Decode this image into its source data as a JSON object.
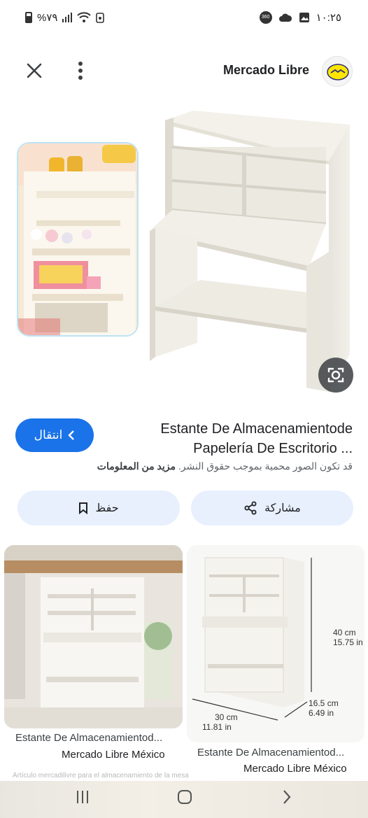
{
  "status_bar": {
    "battery": "%٧٩",
    "time": "١٠:٢٥",
    "badge_360": "360"
  },
  "header": {
    "site_name": "Mercado Libre"
  },
  "result": {
    "title_line1": "Estante De Almacenamientode",
    "title_line2": "Papelería De Escritorio ...",
    "visit_label": "انتقال",
    "copyright_notice": "قد تكون الصور محمية بموجب حقوق النشر.",
    "more_info_label": "مزيد من المعلومات"
  },
  "actions": {
    "save_label": "حفظ",
    "share_label": "مشاركة"
  },
  "related": [
    {
      "title": "Estante De Almacenamientod...",
      "source": "Mercado Libre México"
    },
    {
      "title": "Estante De Almacenamientod...",
      "source": "Mercado Libre México"
    }
  ],
  "dimension_labels": {
    "height": "40 cm",
    "height_in": "15.75 in",
    "depth": "16.5 cm",
    "depth_in": "6.49 in",
    "width": "30 cm",
    "width_in": "11.81 in"
  },
  "faded_caption": "Artículo mercadilivre para el almacenamiento de la mesa",
  "colors": {
    "accent": "#1a73e8",
    "action_bg": "#e8f0fe",
    "text_primary": "#202124",
    "text_secondary": "#5f6368"
  }
}
